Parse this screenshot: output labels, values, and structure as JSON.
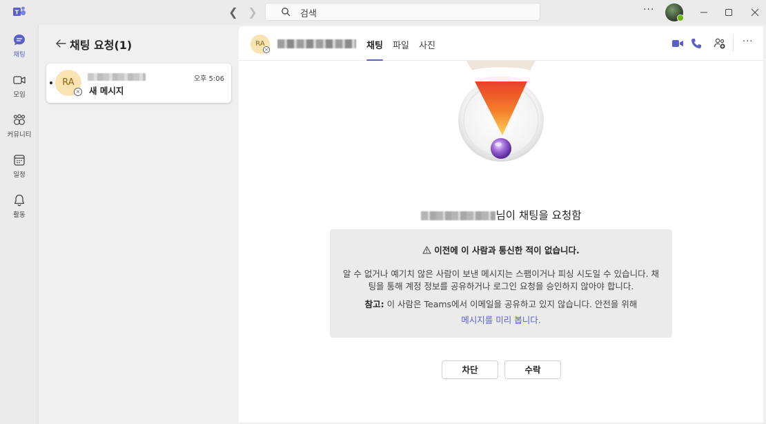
{
  "titlebar": {
    "search_placeholder": "검색",
    "more_label": "···"
  },
  "rail": {
    "items": [
      {
        "label": "채팅",
        "icon": "chat-icon",
        "active": true
      },
      {
        "label": "모임",
        "icon": "video-icon",
        "active": false
      },
      {
        "label": "커뮤니티",
        "icon": "community-icon",
        "active": false
      },
      {
        "label": "일정",
        "icon": "calendar-icon",
        "active": false
      },
      {
        "label": "활동",
        "icon": "bell-icon",
        "active": false
      }
    ]
  },
  "list": {
    "title": "채팅 요청(1)",
    "card": {
      "avatar_initials": "RA",
      "time": "오후 5:06",
      "message": "새 메시지"
    }
  },
  "conversation": {
    "avatar_initials": "RA",
    "tabs": [
      "채팅",
      "파일",
      "사진"
    ],
    "more_label": "···",
    "request_heading_suffix": "님이 채팅을 요청함",
    "warning_title": "이전에 이 사람과 통신한 적이 없습니다.",
    "warning_body": "알 수 없거나 예기치 않은 사람이 보낸 메시지는 스팸이거나 피싱 시도일 수 있습니다. 채팅을 통해 계정 정보를 공유하거나 로그인 요청을 승인하지 않아야 합니다.",
    "note_label": "참고:",
    "note_text": " 이 사람은 Teams에서 이메일을 공유하고 있지 않습니다. 안전을 위해",
    "preview_link": "메시지를 미리 봅니다.",
    "block_button": "차단",
    "accept_button": "수락"
  },
  "colors": {
    "accent": "#5b5fc7",
    "avatar_bg": "#fbe4b4",
    "presence": "#6bb700"
  }
}
